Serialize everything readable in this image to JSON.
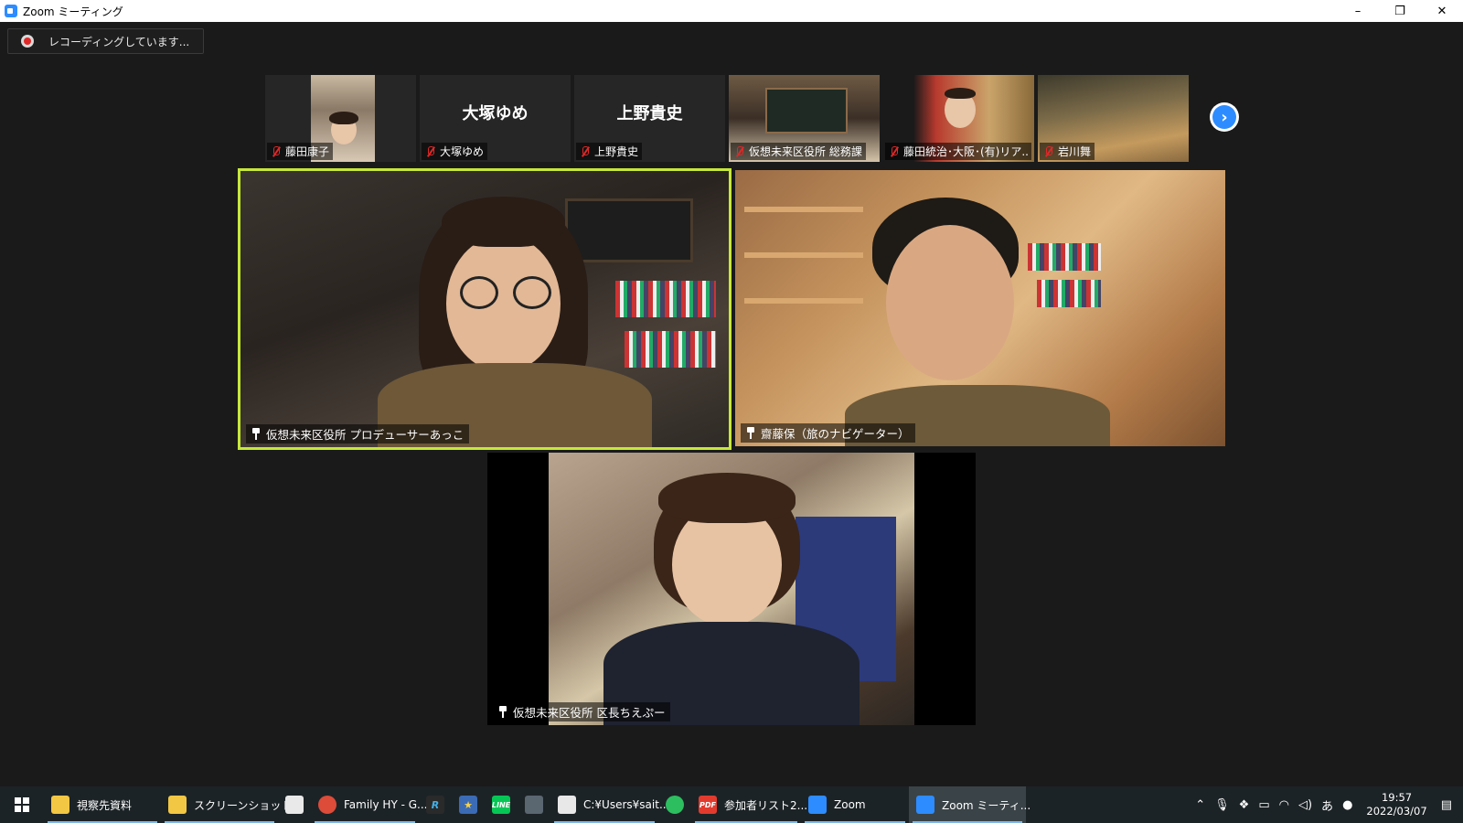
{
  "window": {
    "title": "Zoom ミーティング",
    "controls": {
      "minimize": "–",
      "restore": "❐",
      "close": "✕"
    }
  },
  "recording": {
    "label": "レコーディングしています..."
  },
  "thumbnails": [
    {
      "name": "藤田康子",
      "big_name": "",
      "muted": true,
      "has_video": true
    },
    {
      "name": "大塚ゆめ",
      "big_name": "大塚ゆめ",
      "muted": true,
      "has_video": false
    },
    {
      "name": "上野貴史",
      "big_name": "上野貴史",
      "muted": true,
      "has_video": false
    },
    {
      "name": "仮想未来区役所 総務課",
      "big_name": "",
      "muted": true,
      "has_video": true
    },
    {
      "name": "藤田統治･大阪･(有)リア...",
      "big_name": "",
      "muted": true,
      "has_video": true
    },
    {
      "name": "岩川舞",
      "big_name": "",
      "muted": true,
      "has_video": true
    }
  ],
  "next_button": {
    "glyph": "›"
  },
  "tiles": {
    "a": {
      "name": "仮想未来区役所 プロデューサーあっこ",
      "active_speaker": true
    },
    "b": {
      "name": "齋藤保（旅のナビゲーター）"
    },
    "c": {
      "name": "仮想未来区役所 区長ちえぷー"
    }
  },
  "taskbar": {
    "items": [
      {
        "label": "視察先資料",
        "icon": "folder-icon",
        "color": "#f2c744"
      },
      {
        "label": "スクリーンショット",
        "icon": "folder-icon",
        "color": "#f2c744"
      },
      {
        "label": "",
        "icon": "mail-icon",
        "color": "#e9e9e9"
      },
      {
        "label": "Family HY - G...",
        "icon": "chrome-icon",
        "color": "#dd4b39"
      },
      {
        "label": "",
        "icon": "r-app-icon",
        "color": "#2a2a2a"
      },
      {
        "label": "",
        "icon": "star-app-icon",
        "color": "#3b6bb5"
      },
      {
        "label": "",
        "icon": "line-icon",
        "color": "#06c755"
      },
      {
        "label": "",
        "icon": "calculator-icon",
        "color": "#5a6670"
      },
      {
        "label": "C:¥Users¥sait...",
        "icon": "notepad-icon",
        "color": "#e8e8e8"
      },
      {
        "label": "",
        "icon": "evernote-icon",
        "color": "#2dbe60"
      },
      {
        "label": "参加者リスト2...",
        "icon": "pdf-icon",
        "color": "#e23b2e"
      },
      {
        "label": "Zoom",
        "icon": "zoom-icon",
        "color": "#2D8CFF"
      },
      {
        "label": "Zoom ミーティ...",
        "icon": "zoom-meeting-icon",
        "color": "#2D8CFF"
      }
    ],
    "tray": {
      "ime": "あ",
      "time": "19:57",
      "date": "2022/03/07"
    }
  }
}
